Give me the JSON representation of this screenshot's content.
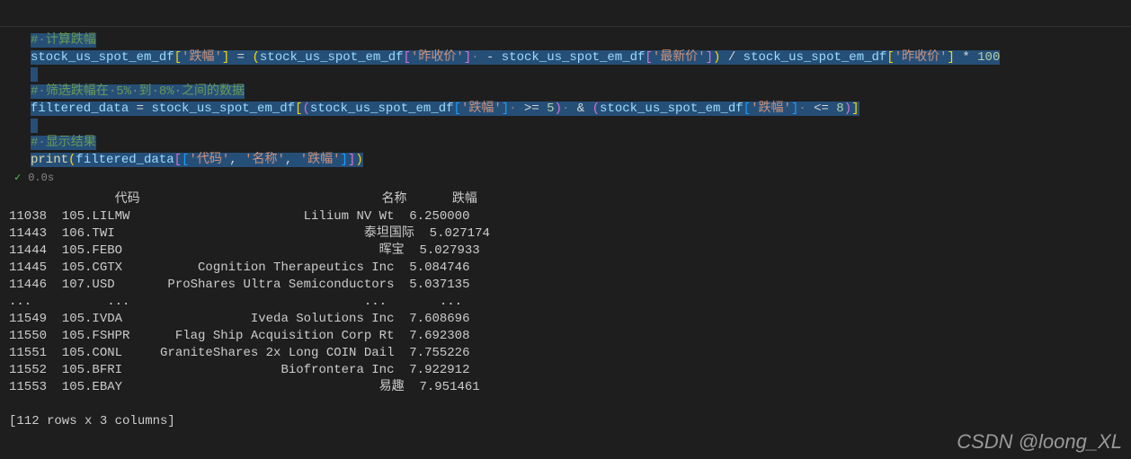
{
  "code": {
    "c1_comment_prefix": "#",
    "c1_dot": "·",
    "c1_comment_text": "计算跌幅",
    "line2_seg1": "stock_us_spot_em_df",
    "line2_bracket_open": "[",
    "line2_str_dropcol": "'跌幅'",
    "line2_bracket_close": "]",
    "line2_eq": " = ",
    "line2_paren_open": "(",
    "line2_seg2": "stock_us_spot_em_df",
    "line2_str_prev": "'昨收价'",
    "line2_minus": " - ",
    "line2_str_latest": "'最新价'",
    "line2_paren_close": ")",
    "line2_div": " / ",
    "line2_mul": " * ",
    "line2_hundred": "100",
    "c2_comment_text": "筛选跌幅在",
    "c2_5": "5%",
    "c2_to": "到",
    "c2_8": "8%",
    "c2_between": "之间的数据",
    "line4_filtered": "filtered_data",
    "line4_ge": " >= ",
    "line4_5": "5",
    "line4_and": " & ",
    "line4_le": " <= ",
    "line4_8": "8",
    "c3_comment_text": "显示结果",
    "line6_print": "print",
    "line6_code": "'代码'",
    "line6_name": "'名称'",
    "line6_drop": "'跌幅'",
    "line6_comma": ", "
  },
  "status": {
    "time": "0.0s"
  },
  "output": {
    "header_code": "代码",
    "header_name": "名称",
    "header_drop": "跌幅",
    "rows": [
      {
        "idx": "11038",
        "code": "105.LILMW",
        "name": "Lilium NV Wt",
        "drop": "6.250000"
      },
      {
        "idx": "11443",
        "code": "106.TWI",
        "name": "泰坦国际",
        "drop": "5.027174"
      },
      {
        "idx": "11444",
        "code": "105.FEBO",
        "name": "晖宝",
        "drop": "5.027933"
      },
      {
        "idx": "11445",
        "code": "105.CGTX",
        "name": "Cognition Therapeutics Inc",
        "drop": "5.084746"
      },
      {
        "idx": "11446",
        "code": "107.USD",
        "name": "ProShares Ultra Semiconductors",
        "drop": "5.037135"
      },
      {
        "idx": "...",
        "code": "...",
        "name": "...",
        "drop": "..."
      },
      {
        "idx": "11549",
        "code": "105.IVDA",
        "name": "Iveda Solutions Inc",
        "drop": "7.608696"
      },
      {
        "idx": "11550",
        "code": "105.FSHPR",
        "name": "Flag Ship Acquisition Corp Rt",
        "drop": "7.692308"
      },
      {
        "idx": "11551",
        "code": "105.CONL",
        "name": "GraniteShares 2x Long COIN Dail",
        "drop": "7.755226"
      },
      {
        "idx": "11552",
        "code": "105.BFRI",
        "name": "Biofrontera Inc",
        "drop": "7.922912"
      },
      {
        "idx": "11553",
        "code": "105.EBAY",
        "name": "易趣",
        "drop": "7.951461"
      }
    ],
    "footer": "[112 rows x 3 columns]"
  },
  "watermark": "CSDN @loong_XL"
}
